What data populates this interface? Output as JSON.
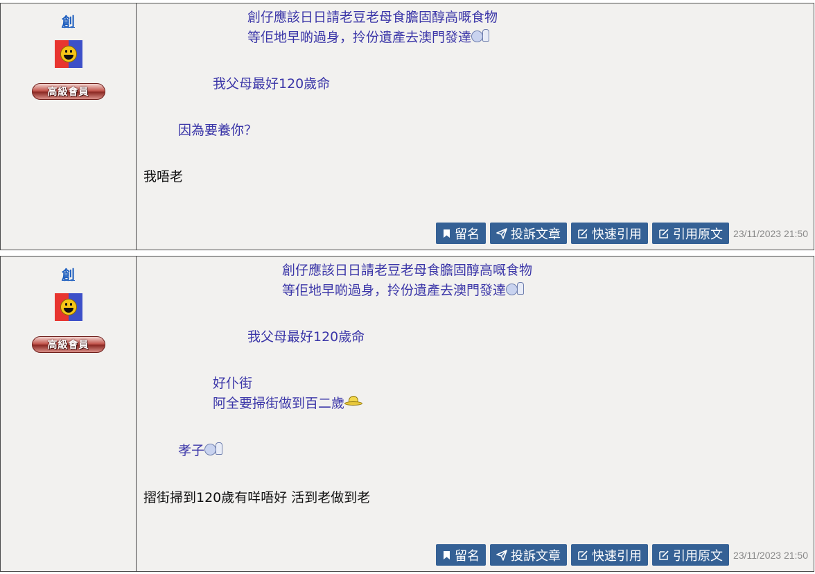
{
  "posts": [
    {
      "author": "創",
      "rank": "高級會員",
      "quotes": [
        {
          "lines": [
            "創仔應該日日請老豆老母食膽固醇高嘅食物",
            "等佢地早啲過身，拎份遺產去澳門發達"
          ],
          "icon": "thumbs-up-smiley-icon"
        },
        {
          "lines": [
            "我父母最好120歲命"
          ]
        },
        {
          "lines": [
            "因為要養你？"
          ]
        }
      ],
      "reply": "我唔老",
      "actions": {
        "bookmark": "留名",
        "report": "投訴文章",
        "quick_quote": "快速引用",
        "quote_original": "引用原文"
      },
      "timestamp": "23/11/2023 21:50"
    },
    {
      "author": "創",
      "rank": "高級會員",
      "quotes": [
        {
          "lines": [
            "創仔應該日日請老豆老母食膽固醇高嘅食物",
            "等佢地早啲過身，拎份遺產去澳門發達"
          ],
          "icon": "thumbs-up-smiley-icon"
        },
        {
          "lines": [
            "我父母最好120歲命"
          ]
        },
        {
          "lines": [
            "好仆街",
            "阿全要掃街做到百二歲"
          ],
          "icon": "hat-smiley-icon"
        },
        {
          "lines": [
            "孝子"
          ],
          "icon": "thumbs-up-smiley-icon"
        }
      ],
      "reply": "摺街掃到120歲有咩唔好 活到老做到老",
      "actions": {
        "bookmark": "留名",
        "report": "投訴文章",
        "quick_quote": "快速引用",
        "quote_original": "引用原文"
      },
      "timestamp": "23/11/2023 21:50"
    }
  ]
}
